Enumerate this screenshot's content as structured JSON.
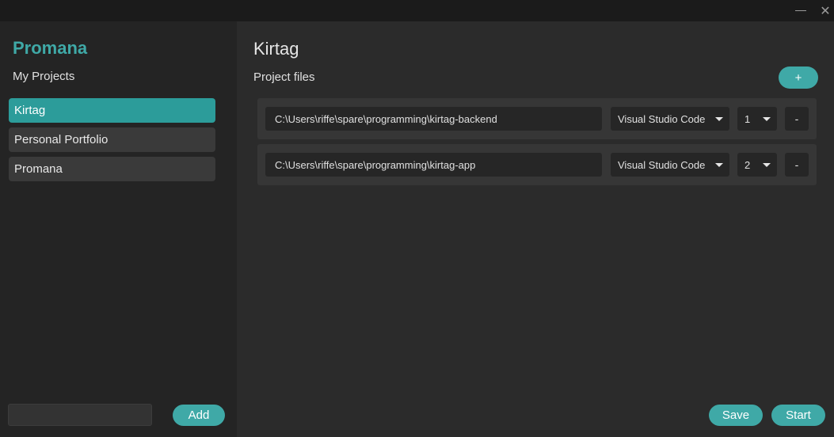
{
  "window": {
    "minimize_label": "—",
    "close_label": "✕"
  },
  "sidebar": {
    "brand": "Promana",
    "subtitle": "My Projects",
    "items": [
      {
        "label": "Kirtag"
      },
      {
        "label": "Personal Portfolio"
      },
      {
        "label": "Promana"
      }
    ],
    "new_project_input": {
      "value": "",
      "placeholder": ""
    },
    "add_label": "Add"
  },
  "main": {
    "title": "Kirtag",
    "files_label": "Project files",
    "add_file_label": "+",
    "files": [
      {
        "path": "C:\\Users\\riffe\\spare\\programming\\kirtag-backend",
        "editor": "Visual Studio Code",
        "order": "1",
        "remove_label": "-"
      },
      {
        "path": "C:\\Users\\riffe\\spare\\programming\\kirtag-app",
        "editor": "Visual Studio Code",
        "order": "2",
        "remove_label": "-"
      }
    ],
    "save_label": "Save",
    "start_label": "Start"
  },
  "colors": {
    "accent": "#3fa9a7",
    "active_item": "#2c9c9a",
    "sidebar_bg": "#242424",
    "main_bg": "#2b2b2b"
  }
}
